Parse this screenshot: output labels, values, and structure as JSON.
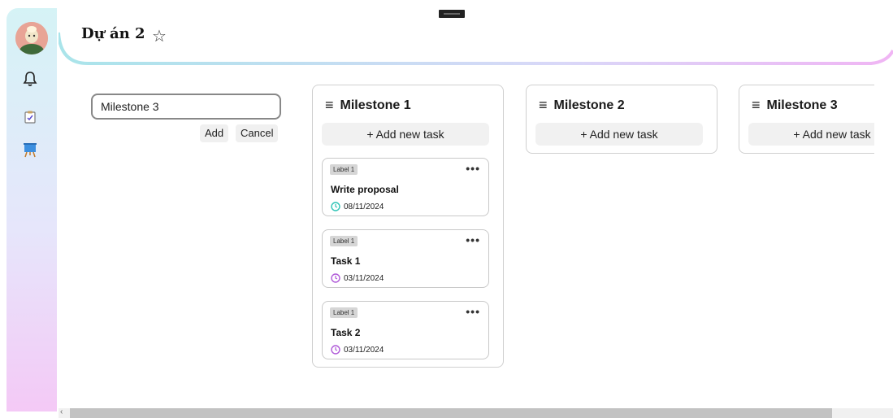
{
  "header": {
    "title": "Dự án 2",
    "star_icon": "star-outline-icon"
  },
  "sidebar": {
    "items": [
      {
        "icon": "bell-icon"
      },
      {
        "icon": "checklist-icon"
      },
      {
        "icon": "board-icon"
      }
    ]
  },
  "new_milestone": {
    "value": "Milestone 3",
    "add_label": "Add",
    "cancel_label": "Cancel"
  },
  "columns": [
    {
      "title": "Milestone 1",
      "add_label": "+ Add new task",
      "tasks": [
        {
          "label": "Label 1",
          "name": "Write proposal",
          "date": "08/11/2024",
          "clock_color": "#2ec4b6"
        },
        {
          "label": "Label 1",
          "name": "Task 1",
          "date": "03/11/2024",
          "clock_color": "#b05ad8"
        },
        {
          "label": "Label 1",
          "name": "Task 2",
          "date": "03/11/2024",
          "clock_color": "#b05ad8"
        }
      ]
    },
    {
      "title": "Milestone 2",
      "add_label": "+ Add new task",
      "tasks": []
    },
    {
      "title": "Milestone 3",
      "add_label": "+ Add new task",
      "tasks": []
    }
  ],
  "more_icon": "•••",
  "menu_icon": "≡",
  "scroll_left_icon": "‹"
}
